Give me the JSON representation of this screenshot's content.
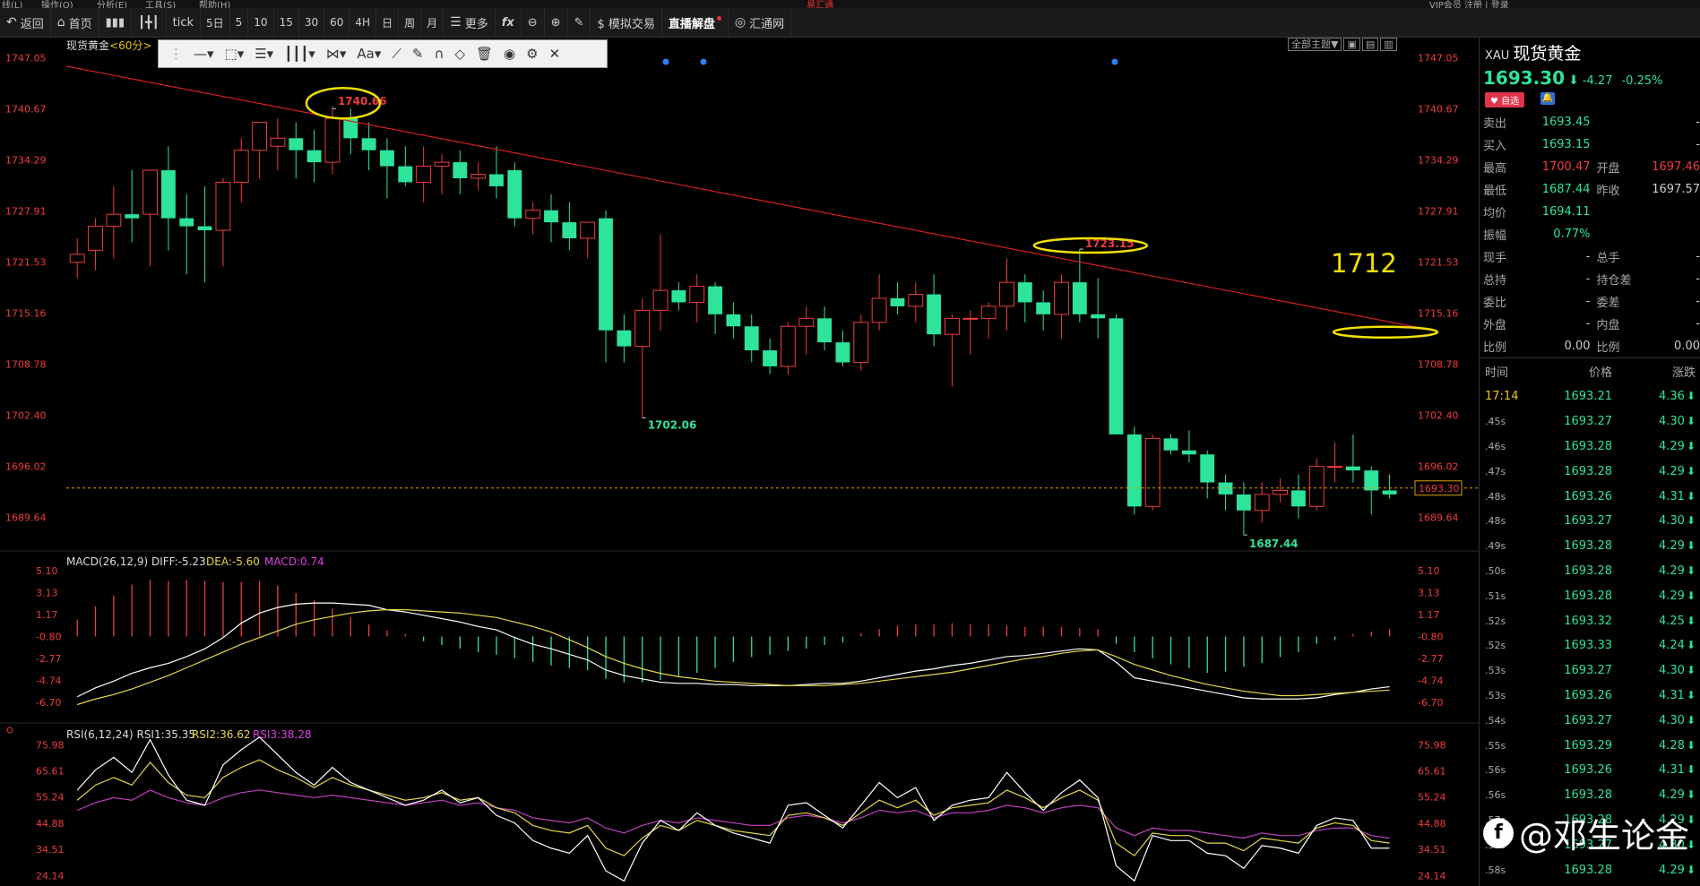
{
  "menubar": {
    "items": [
      "线(L)",
      "操作(O)",
      "分析(E)",
      "工具(S)",
      "帮助(H)"
    ],
    "app": "易汇通",
    "right": "VIP会员  注册 | 登录"
  },
  "toolbar": {
    "back": "返回",
    "home": "首页",
    "tick": "tick",
    "day5": "5日",
    "periods": [
      "5",
      "10",
      "15",
      "30",
      "60",
      "4H",
      "日",
      "周",
      "月"
    ],
    "more": "更多",
    "fx": "fx",
    "sim": "$ 模拟交易",
    "live": "直播解盘",
    "hui": "汇通网"
  },
  "chart": {
    "title": "现货黄金",
    "period": "<60分>",
    "theme": "全部主题▼",
    "ylabels": [
      "1747.05",
      "1740.67",
      "1734.29",
      "1727.91",
      "1721.53",
      "1715.16",
      "1708.78",
      "1702.40",
      "1696.02",
      "1689.64"
    ],
    "current_price": "1693.30",
    "annotation": "1712",
    "marks": {
      "high1": "1740.66",
      "high2": "1723.15",
      "low1": "1702.06",
      "low2": "1687.44"
    },
    "macd_label": "MACD(26,12,9) DIFF:-5.23",
    "dea_label": "DEA:-5.60",
    "macd_value": "MACD:0.74",
    "macd_ylabels": [
      "5.10",
      "3.13",
      "1.17",
      "-0.80",
      "-2.77",
      "-4.74",
      "-6.70"
    ],
    "rsi_label": "RSI(6,12,24) RSI1:35.35",
    "rsi2": "RSI2:36.62",
    "rsi3": "RSI3:38.28",
    "rsi_ylabels": [
      "75.98",
      "65.61",
      "55.24",
      "44.88",
      "34.51",
      "24.14"
    ]
  },
  "chart_data": {
    "type": "candlestick",
    "title": "现货黄金 60分",
    "candles": [
      [
        1721.5,
        1724.5,
        1719.5,
        1722.5
      ],
      [
        1723,
        1727,
        1720.5,
        1726
      ],
      [
        1726,
        1731,
        1722,
        1727.5
      ],
      [
        1727.5,
        1733,
        1724,
        1727
      ],
      [
        1727.5,
        1731.5,
        1721,
        1733
      ],
      [
        1733,
        1736,
        1723,
        1727
      ],
      [
        1727,
        1730,
        1720,
        1726
      ],
      [
        1726,
        1731,
        1719,
        1725.5
      ],
      [
        1725.5,
        1732,
        1721,
        1731.5
      ],
      [
        1731.5,
        1737,
        1729,
        1735.5
      ],
      [
        1735.5,
        1739,
        1732,
        1739
      ],
      [
        1736,
        1739.5,
        1733,
        1737
      ],
      [
        1737,
        1739,
        1732,
        1735.5
      ],
      [
        1735.5,
        1738,
        1731.5,
        1734
      ],
      [
        1734,
        1741,
        1732.5,
        1739.5
      ],
      [
        1739.5,
        1740.7,
        1735,
        1737
      ],
      [
        1737,
        1739,
        1733,
        1735.5
      ],
      [
        1735.5,
        1737,
        1729.5,
        1733.5
      ],
      [
        1733.5,
        1736,
        1731,
        1731.5
      ],
      [
        1731.5,
        1736,
        1729,
        1733.5
      ],
      [
        1733.5,
        1735,
        1730,
        1734
      ],
      [
        1734,
        1735.5,
        1730,
        1732
      ],
      [
        1732,
        1734,
        1730.5,
        1732.5
      ],
      [
        1732.5,
        1736,
        1729.5,
        1731
      ],
      [
        1733,
        1734,
        1726,
        1727
      ],
      [
        1727,
        1729,
        1725,
        1728
      ],
      [
        1728,
        1730,
        1724,
        1726.5
      ],
      [
        1726.5,
        1729,
        1723,
        1724.5
      ],
      [
        1724.5,
        1726,
        1722,
        1726.5
      ],
      [
        1727,
        1728,
        1709,
        1713
      ],
      [
        1713,
        1715,
        1709,
        1711
      ],
      [
        1711,
        1717,
        1702.06,
        1715.5
      ],
      [
        1715.5,
        1725,
        1713,
        1718
      ],
      [
        1718,
        1719,
        1715.5,
        1716.5
      ],
      [
        1716.5,
        1720,
        1714,
        1718.5
      ],
      [
        1718.5,
        1719,
        1712.5,
        1715
      ],
      [
        1715,
        1716.5,
        1712,
        1713.5
      ],
      [
        1713.5,
        1715,
        1709,
        1710.5
      ],
      [
        1710.5,
        1712,
        1707.5,
        1708.5
      ],
      [
        1708.5,
        1714,
        1707.5,
        1713.5
      ],
      [
        1713.5,
        1716,
        1710,
        1714.5
      ],
      [
        1714.5,
        1716,
        1710.5,
        1711.5
      ],
      [
        1711.5,
        1713,
        1708.5,
        1709
      ],
      [
        1709,
        1715,
        1708,
        1714
      ],
      [
        1714,
        1720,
        1713,
        1717
      ],
      [
        1717,
        1719,
        1715,
        1716
      ],
      [
        1716,
        1719,
        1714,
        1717.5
      ],
      [
        1717.5,
        1720,
        1711,
        1712.5
      ],
      [
        1712.5,
        1715,
        1706,
        1714.5
      ],
      [
        1714.5,
        1715.5,
        1710,
        1714.5
      ],
      [
        1714.5,
        1716.5,
        1712,
        1716
      ],
      [
        1716,
        1722,
        1713,
        1719
      ],
      [
        1719,
        1720,
        1714,
        1716.5
      ],
      [
        1716.5,
        1718,
        1713,
        1715
      ],
      [
        1715,
        1720,
        1712,
        1719
      ],
      [
        1719,
        1723.15,
        1714,
        1715
      ],
      [
        1715,
        1719.5,
        1712,
        1714.5
      ],
      [
        1714.5,
        1715,
        1700,
        1700
      ],
      [
        1700,
        1701,
        1690,
        1691
      ],
      [
        1691,
        1700,
        1690.5,
        1699.5
      ],
      [
        1699.5,
        1700,
        1697.5,
        1698
      ],
      [
        1698,
        1700.5,
        1696.5,
        1697.5
      ],
      [
        1697.5,
        1698,
        1692,
        1694
      ],
      [
        1694,
        1695,
        1690.5,
        1692.5
      ],
      [
        1692.5,
        1694,
        1687.44,
        1690.5
      ],
      [
        1690.5,
        1694,
        1689,
        1692.5
      ],
      [
        1692.5,
        1694.5,
        1691.5,
        1693
      ],
      [
        1693,
        1695,
        1689.5,
        1691
      ],
      [
        1691,
        1697,
        1690.5,
        1696
      ],
      [
        1696,
        1699,
        1694,
        1696
      ],
      [
        1696,
        1700,
        1694,
        1695.5
      ],
      [
        1695.5,
        1696,
        1690,
        1693
      ],
      [
        1693,
        1695,
        1692,
        1692.5
      ]
    ],
    "trendline": [
      [
        0,
        1746
      ],
      [
        75,
        1713
      ]
    ],
    "ylim": [
      1686,
      1748
    ],
    "macd_ylim": [
      -6.7,
      5.1
    ],
    "diff": [
      -6.2,
      -5.4,
      -4.8,
      -4.1,
      -3.6,
      -3.2,
      -2.6,
      -1.9,
      -0.9,
      0.4,
      1.3,
      1.8,
      2.1,
      2.2,
      2.2,
      2.1,
      2.0,
      1.6,
      1.4,
      1.1,
      0.8,
      0.5,
      0.1,
      -0.2,
      -0.9,
      -1.5,
      -1.9,
      -2.4,
      -2.9,
      -3.8,
      -4.3,
      -4.6,
      -4.9,
      -5.0,
      -5.0,
      -5.1,
      -5.1,
      -5.2,
      -5.2,
      -5.2,
      -5.1,
      -5.0,
      -5.0,
      -4.8,
      -4.5,
      -4.2,
      -3.9,
      -3.7,
      -3.4,
      -3.2,
      -2.9,
      -2.6,
      -2.5,
      -2.3,
      -2.1,
      -1.9,
      -2.0,
      -3.1,
      -4.5,
      -4.8,
      -5.1,
      -5.4,
      -5.7,
      -6.0,
      -6.3,
      -6.4,
      -6.4,
      -6.4,
      -6.3,
      -6.0,
      -5.8,
      -5.5,
      -5.3
    ],
    "dea": [
      -6.9,
      -6.4,
      -6.0,
      -5.5,
      -4.9,
      -4.3,
      -3.6,
      -2.9,
      -2.2,
      -1.5,
      -0.9,
      -0.3,
      0.3,
      0.7,
      1.0,
      1.3,
      1.5,
      1.6,
      1.6,
      1.5,
      1.4,
      1.3,
      1.1,
      0.9,
      0.5,
      0.1,
      -0.4,
      -1.1,
      -1.8,
      -2.6,
      -3.2,
      -3.7,
      -4.1,
      -4.4,
      -4.6,
      -4.8,
      -4.9,
      -5.0,
      -5.1,
      -5.2,
      -5.2,
      -5.2,
      -5.1,
      -5.0,
      -4.8,
      -4.6,
      -4.4,
      -4.2,
      -4.0,
      -3.7,
      -3.4,
      -3.1,
      -2.8,
      -2.6,
      -2.3,
      -2.1,
      -2.0,
      -2.6,
      -3.3,
      -3.8,
      -4.3,
      -4.7,
      -5.1,
      -5.4,
      -5.7,
      -5.9,
      -6.1,
      -6.1,
      -6.0,
      -5.9,
      -5.8,
      -5.7,
      -5.6
    ],
    "macd_hist": [
      1.4,
      2.5,
      3.4,
      4.3,
      4.7,
      4.6,
      4.7,
      4.6,
      4.5,
      4.5,
      4.6,
      4.2,
      3.6,
      3.0,
      2.3,
      1.6,
      1.0,
      0.5,
      0.2,
      -0.4,
      -0.7,
      -1.0,
      -1.3,
      -1.5,
      -1.8,
      -2.1,
      -2.4,
      -2.6,
      -2.8,
      -3.5,
      -3.8,
      -3.8,
      -3.6,
      -3.3,
      -3.0,
      -2.6,
      -2.1,
      -1.7,
      -1.5,
      -1.2,
      -1.0,
      -0.7,
      -0.5,
      0.3,
      0.6,
      0.9,
      1.0,
      1.0,
      1.1,
      1.0,
      1.0,
      0.9,
      0.8,
      0.8,
      0.8,
      0.7,
      0.6,
      -0.6,
      -1.3,
      -1.8,
      -2.3,
      -2.6,
      -3.0,
      -2.9,
      -2.5,
      -2.2,
      -1.7,
      -1.3,
      -0.6,
      -0.3,
      0.2,
      0.4,
      0.6
    ],
    "rsi_ylim": [
      20,
      80
    ],
    "rsi1": [
      58,
      66,
      71,
      65,
      78,
      64,
      54,
      52,
      68,
      74,
      79,
      72,
      65,
      60,
      67,
      61,
      58,
      55,
      52,
      54,
      58,
      53,
      55,
      48,
      45,
      38,
      35,
      33,
      40,
      26,
      22,
      37,
      46,
      42,
      49,
      44,
      41,
      39,
      37,
      52,
      53,
      48,
      43,
      52,
      61,
      55,
      59,
      46,
      52,
      54,
      55,
      65,
      57,
      50,
      57,
      62,
      55,
      28,
      22,
      40,
      38,
      38,
      33,
      32,
      27,
      36,
      35,
      33,
      44,
      47,
      46,
      35,
      35
    ],
    "rsi2": [
      54,
      60,
      63,
      60,
      69,
      61,
      56,
      55,
      63,
      67,
      70,
      66,
      63,
      59,
      63,
      60,
      58,
      56,
      54,
      55,
      57,
      54,
      55,
      51,
      49,
      44,
      42,
      41,
      44,
      35,
      32,
      39,
      44,
      42,
      46,
      44,
      42,
      41,
      40,
      48,
      49,
      47,
      44,
      49,
      54,
      51,
      54,
      48,
      51,
      52,
      53,
      58,
      55,
      51,
      55,
      58,
      54,
      37,
      32,
      41,
      40,
      40,
      37,
      37,
      34,
      39,
      38,
      37,
      43,
      45,
      44,
      38,
      37
    ],
    "rsi3": [
      50,
      53,
      55,
      54,
      58,
      55,
      53,
      52,
      55,
      57,
      58,
      57,
      56,
      55,
      56,
      55,
      54,
      53,
      52,
      53,
      54,
      52,
      53,
      51,
      50,
      47,
      46,
      45,
      47,
      43,
      41,
      44,
      46,
      45,
      47,
      46,
      45,
      44,
      44,
      47,
      48,
      47,
      45,
      47,
      50,
      49,
      50,
      47,
      49,
      49,
      50,
      52,
      51,
      49,
      51,
      52,
      51,
      43,
      40,
      43,
      42,
      42,
      41,
      40,
      39,
      41,
      40,
      40,
      42,
      43,
      43,
      40,
      39
    ]
  },
  "panel": {
    "symbol": "XAU",
    "name": "现货黄金",
    "price": "1693.30",
    "arrow": "⬇",
    "change": "-4.27",
    "pct": "-0.25%",
    "fav": "♥ 自选",
    "bell": "🔔",
    "rows": [
      {
        "l": "卖出",
        "v": "1693.45",
        "l2": "",
        "v2": "-"
      },
      {
        "l": "买入",
        "v": "1693.15",
        "l2": "",
        "v2": "-"
      },
      {
        "l": "最高",
        "v": "1700.47",
        "l2": "开盘",
        "v2": "1697.46"
      },
      {
        "l": "最低",
        "v": "1687.44",
        "l2": "昨收",
        "v2": "1697.57"
      },
      {
        "l": "均价",
        "v": "1694.11",
        "l2": "",
        "v2": ""
      },
      {
        "l": "振幅",
        "v": "0.77%",
        "l2": "",
        "v2": ""
      },
      {
        "l": "现手",
        "v": "-",
        "l2": "总手",
        "v2": "-"
      },
      {
        "l": "总持",
        "v": "-",
        "l2": "持仓差",
        "v2": "-"
      },
      {
        "l": "委比",
        "v": "-",
        "l2": "委差",
        "v2": "-"
      },
      {
        "l": "外盘",
        "v": "-",
        "l2": "内盘",
        "v2": "-"
      },
      {
        "l": "比例",
        "v": "0.00",
        "l2": "比例",
        "v2": "0.00"
      }
    ],
    "thead": [
      "时间",
      "价格",
      "涨跌"
    ],
    "ticks": [
      {
        "t": "17:14",
        "p": "1693.21",
        "c": "4.36"
      },
      {
        "t": ".45s",
        "p": "1693.27",
        "c": "4.30"
      },
      {
        "t": ".46s",
        "p": "1693.28",
        "c": "4.29"
      },
      {
        "t": ".47s",
        "p": "1693.28",
        "c": "4.29"
      },
      {
        "t": ".48s",
        "p": "1693.26",
        "c": "4.31"
      },
      {
        "t": ".48s",
        "p": "1693.27",
        "c": "4.30"
      },
      {
        "t": ".49s",
        "p": "1693.28",
        "c": "4.29"
      },
      {
        "t": ".50s",
        "p": "1693.28",
        "c": "4.29"
      },
      {
        "t": ".51s",
        "p": "1693.28",
        "c": "4.29"
      },
      {
        "t": ".52s",
        "p": "1693.32",
        "c": "4.25"
      },
      {
        "t": ".52s",
        "p": "1693.33",
        "c": "4.24"
      },
      {
        "t": ".53s",
        "p": "1693.27",
        "c": "4.30"
      },
      {
        "t": ".53s",
        "p": "1693.26",
        "c": "4.31"
      },
      {
        "t": ".54s",
        "p": "1693.27",
        "c": "4.30"
      },
      {
        "t": ".55s",
        "p": "1693.29",
        "c": "4.28"
      },
      {
        "t": ".56s",
        "p": "1693.26",
        "c": "4.31"
      },
      {
        "t": ".56s",
        "p": "1693.28",
        "c": "4.29"
      },
      {
        "t": ".57s",
        "p": "1693.28",
        "c": "4.29"
      },
      {
        "t": ".57s",
        "p": "1693.27",
        "c": "4.30"
      },
      {
        "t": ".58s",
        "p": "1693.28",
        "c": "4.29"
      }
    ],
    "watermark": "@邓生论金"
  },
  "colors": {
    "up": "#f03c3c",
    "down": "#2ee39a",
    "trend": "#d42020",
    "circle": "#f0e000",
    "diff": "#ffffff",
    "dea": "#e6d84a",
    "rsi3": "#c040c0"
  }
}
